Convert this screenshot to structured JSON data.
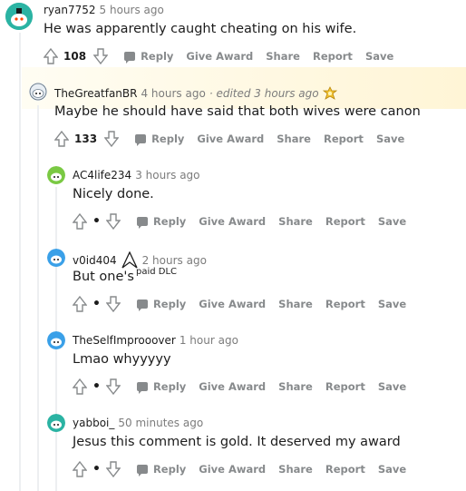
{
  "comments": [
    {
      "user": "ryan7752",
      "time": "5 hours ago",
      "edited": "",
      "text": "He was apparently caught cheating on his wife.",
      "text_sup": "",
      "score": "108"
    },
    {
      "user": "TheGreatfanBR",
      "time": "4 hours ago",
      "edited": "· edited 3 hours ago",
      "text": "Maybe he should have said that both wives were canon",
      "text_sup": "",
      "score": "133"
    },
    {
      "user": "AC4life234",
      "time": "3 hours ago",
      "edited": "",
      "text": "Nicely done.",
      "text_sup": "",
      "score": "•"
    },
    {
      "user": "v0id404",
      "time": "2 hours ago",
      "edited": "",
      "text": "But one's",
      "text_sup": "paid DLC",
      "score": "•"
    },
    {
      "user": "TheSelfImprooover",
      "time": "1 hour ago",
      "edited": "",
      "text": "Lmao whyyyyy",
      "text_sup": "",
      "score": "•"
    },
    {
      "user": "yabboi_",
      "time": "50 minutes ago",
      "edited": "",
      "text": "Jesus this comment is gold. It deserved my award",
      "text_sup": "",
      "score": "•"
    }
  ],
  "actions": {
    "reply": "Reply",
    "give_award": "Give Award",
    "share": "Share",
    "report": "Report",
    "save": "Save"
  },
  "colors": {
    "meta": "#7c7c7c",
    "action": "#878a8c",
    "thread_line": "#edeff1",
    "award_highlight": "#fff8e1",
    "avatar_teal": "#2bb3a3",
    "avatar_blue": "#3aa0e8",
    "avatar_green": "#7ac943"
  },
  "icons": {
    "upvote": "arrow-up-icon",
    "downvote": "arrow-down-icon",
    "reply": "comment-bubble-icon",
    "award": "gold-award-icon",
    "flair": "assassin-insignia-icon"
  }
}
